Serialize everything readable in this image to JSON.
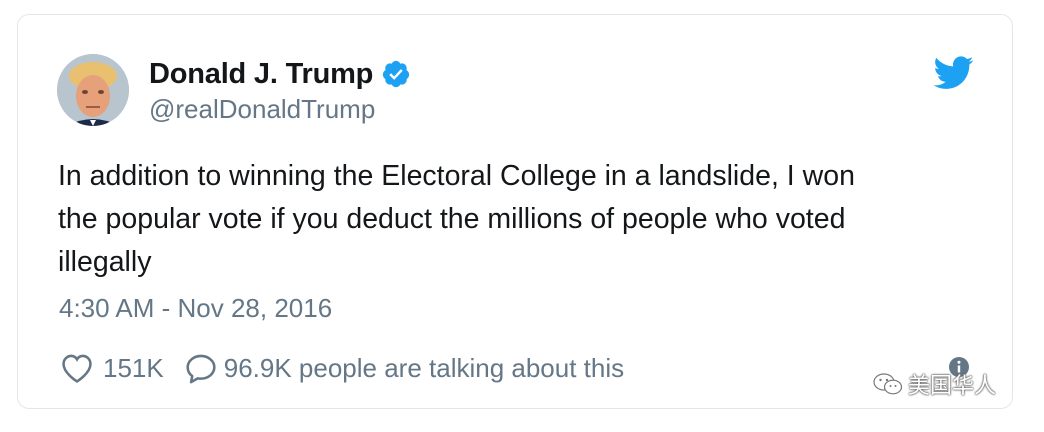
{
  "tweet": {
    "display_name": "Donald J. Trump",
    "handle": "@realDonaldTrump",
    "verified": true,
    "text": "In addition to winning the Electoral College in a landslide, I won\nthe popular vote if you deduct the millions of people who voted\nillegally",
    "timestamp": "4:30 AM - Nov 28, 2016",
    "like_count": "151K",
    "talking_text": "96.9K people are talking about this"
  },
  "icons": {
    "avatar": "profile-photo",
    "verified": "verified-badge-icon",
    "brand": "twitter-bird-icon",
    "like": "heart-icon",
    "reply": "speech-bubble-icon",
    "info": "info-icon"
  },
  "watermark": {
    "text": "美国华人"
  },
  "colors": {
    "verified_blue": "#1da1f2",
    "text_primary": "#14171a",
    "text_secondary": "#657786",
    "card_border": "#e1e8ed"
  }
}
